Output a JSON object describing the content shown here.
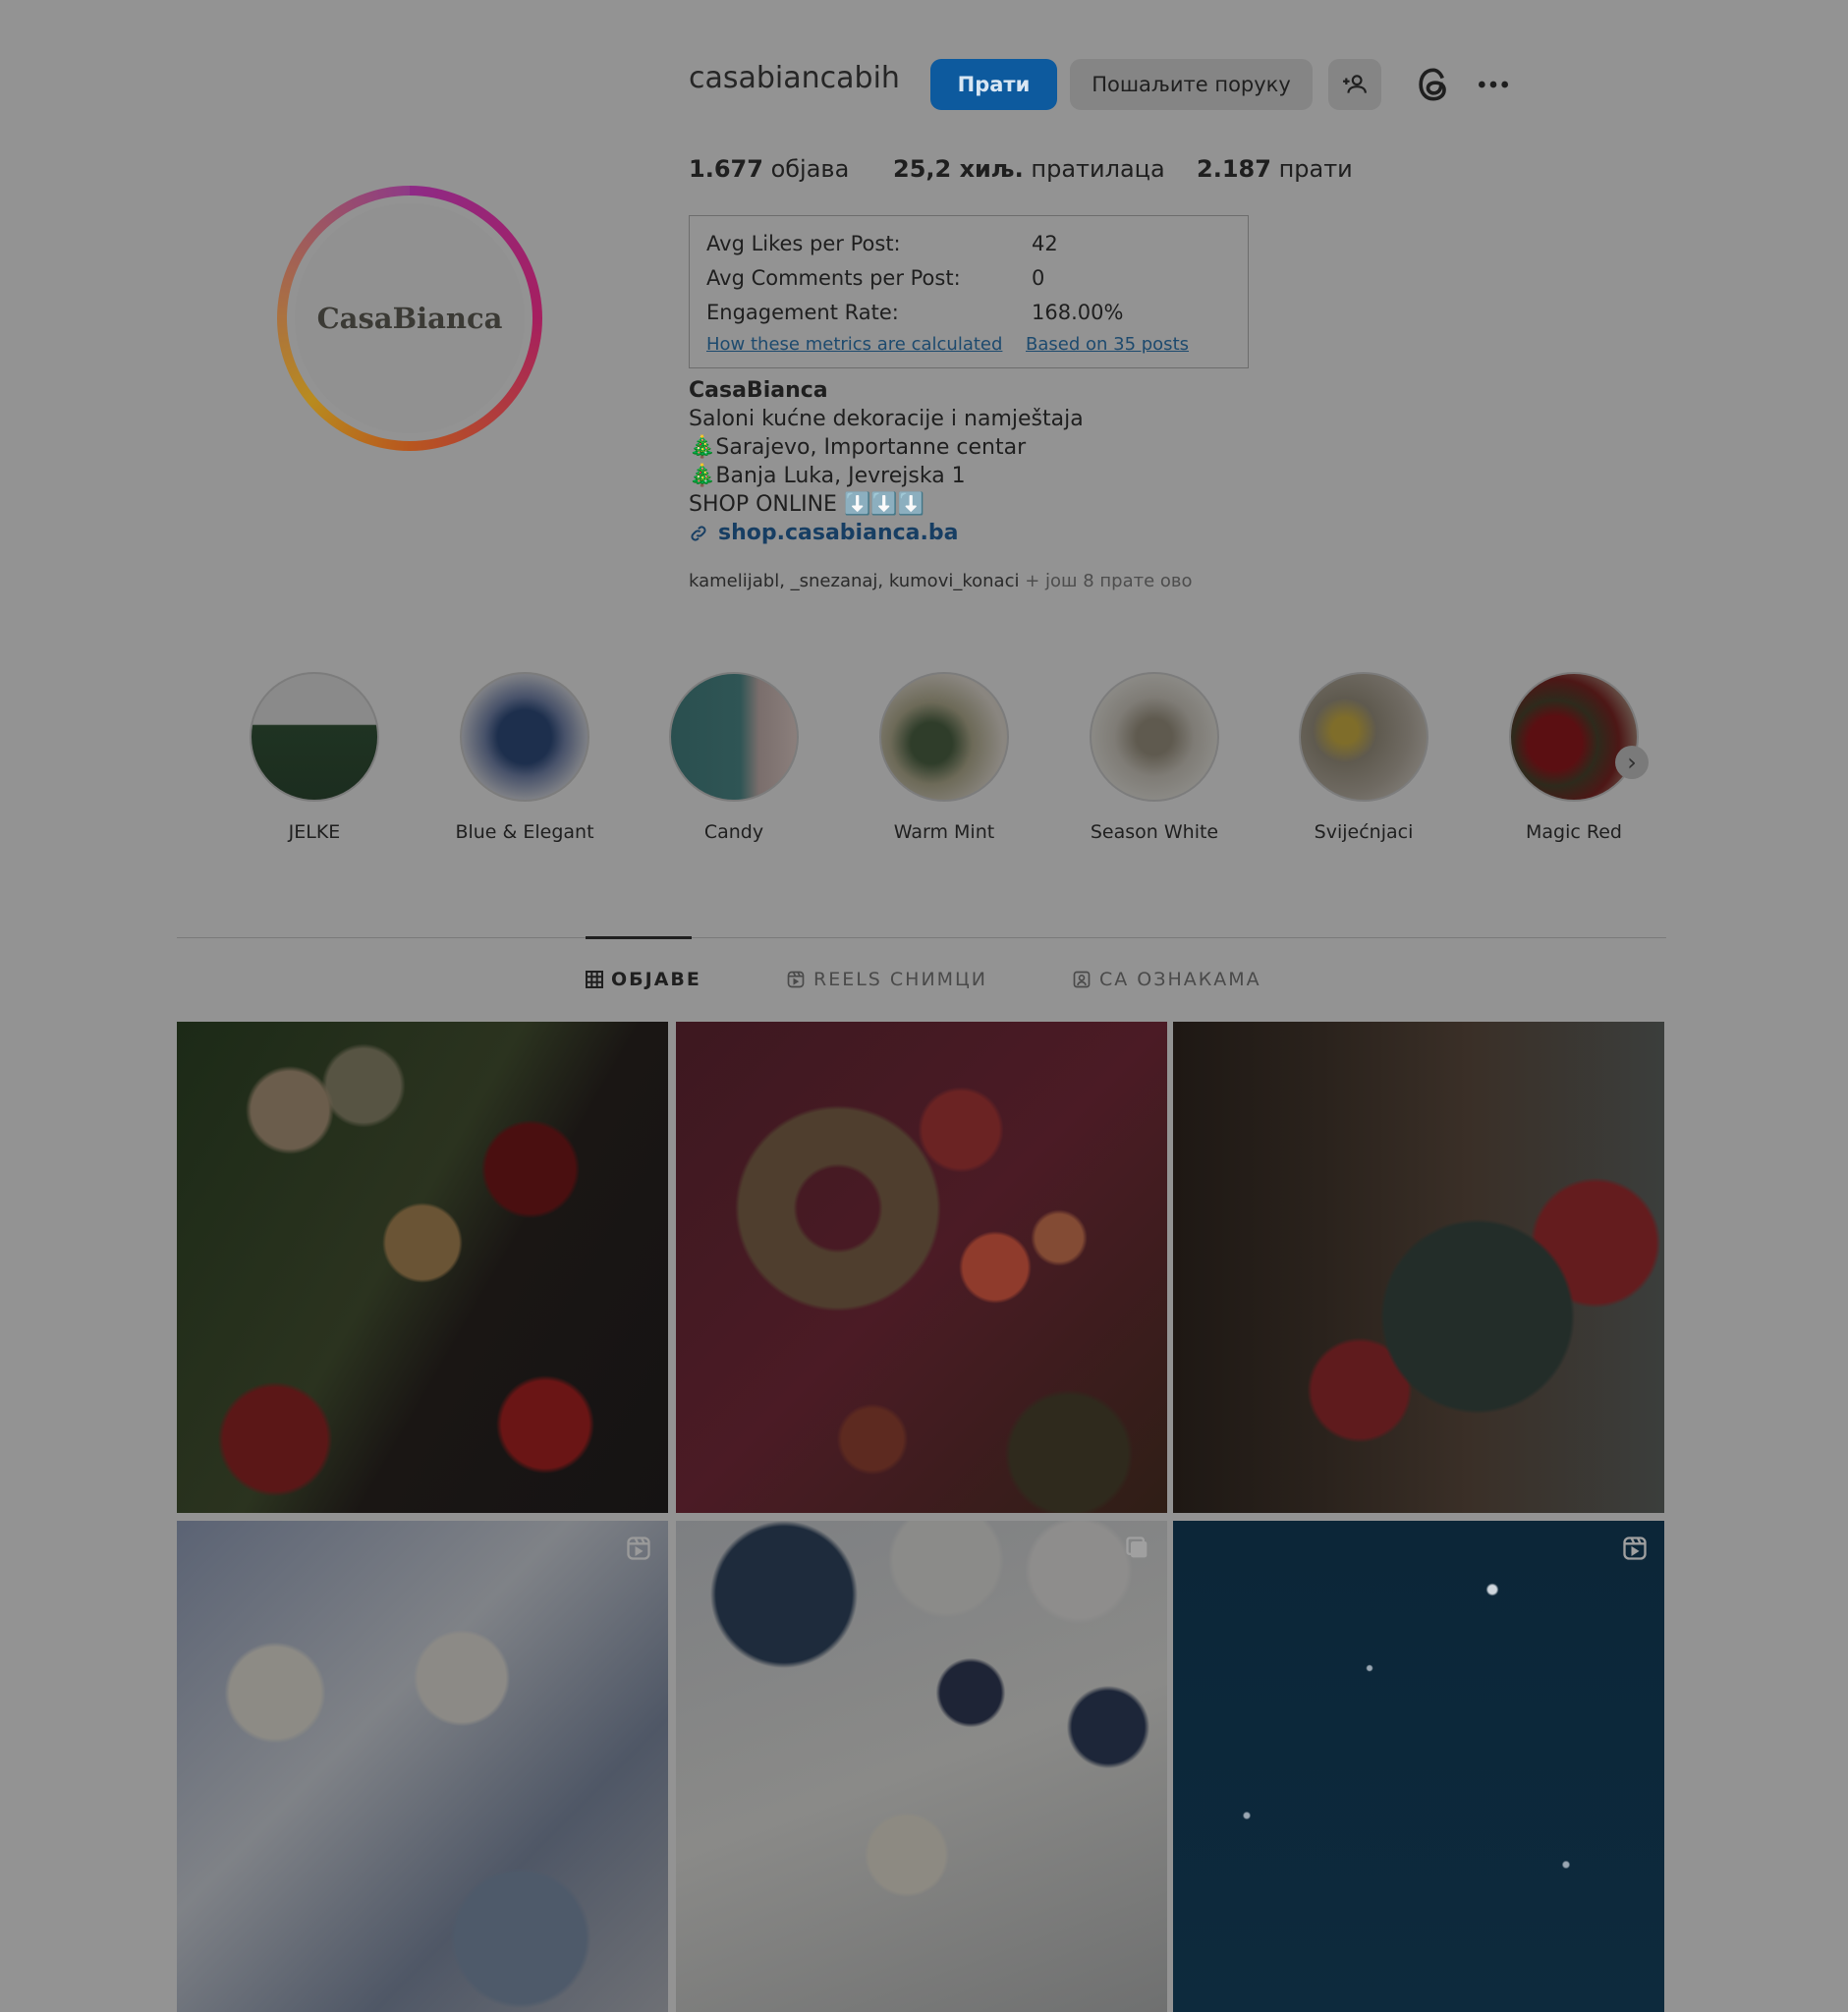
{
  "header": {
    "username": "casabiancabih",
    "follow_label": "Прати",
    "message_label": "Пошаљите поруку",
    "add_user_icon": "person-add-icon",
    "threads_icon": "threads-icon",
    "more_icon": "more-options-icon"
  },
  "stats": {
    "posts_count": "1.677",
    "posts_label": "објава",
    "followers_count": "25,2 хиљ.",
    "followers_label": "пратилаца",
    "following_count": "2.187",
    "following_label": "прати"
  },
  "metrics": {
    "avg_likes_label": "Avg Likes per Post:",
    "avg_likes_value": "42",
    "avg_comments_label": "Avg Comments per Post:",
    "avg_comments_value": "0",
    "engagement_label": "Engagement Rate:",
    "engagement_value": "168.00%",
    "how_link": "How these metrics are calculated",
    "based_link": "Based on 35 posts"
  },
  "avatar": {
    "text": "CasaBianca"
  },
  "bio": {
    "name": "CasaBianca",
    "line1": "Saloni kućne dekoracije i namještaja",
    "line2": "🎄Sarajevo, Importanne centar",
    "line3": "🎄Banja Luka, Jevrejska 1",
    "line4": "SHOP ONLINE ⬇️⬇️⬇️",
    "link": "shop.casabianca.ba"
  },
  "followed_by": {
    "names": "kamelijabl, _snezanaj, kumovi_konaci",
    "more": "+ још 8 прате ово"
  },
  "highlights": [
    {
      "label": "JELKE"
    },
    {
      "label": "Blue & Elegant"
    },
    {
      "label": "Candy"
    },
    {
      "label": "Warm Mint"
    },
    {
      "label": "Season White"
    },
    {
      "label": "Svijećnjaci"
    },
    {
      "label": "Magic Red"
    }
  ],
  "tabs": [
    {
      "label": "ОБЈАВЕ",
      "icon": "grid-icon"
    },
    {
      "label": "REELS СНИМЦИ",
      "icon": "reels-icon"
    },
    {
      "label": "СА ОЗНАКАМА",
      "icon": "tagged-icon"
    }
  ],
  "colors": {
    "follow_button": "#0d5a9e",
    "overlay_dim": "#939393"
  }
}
